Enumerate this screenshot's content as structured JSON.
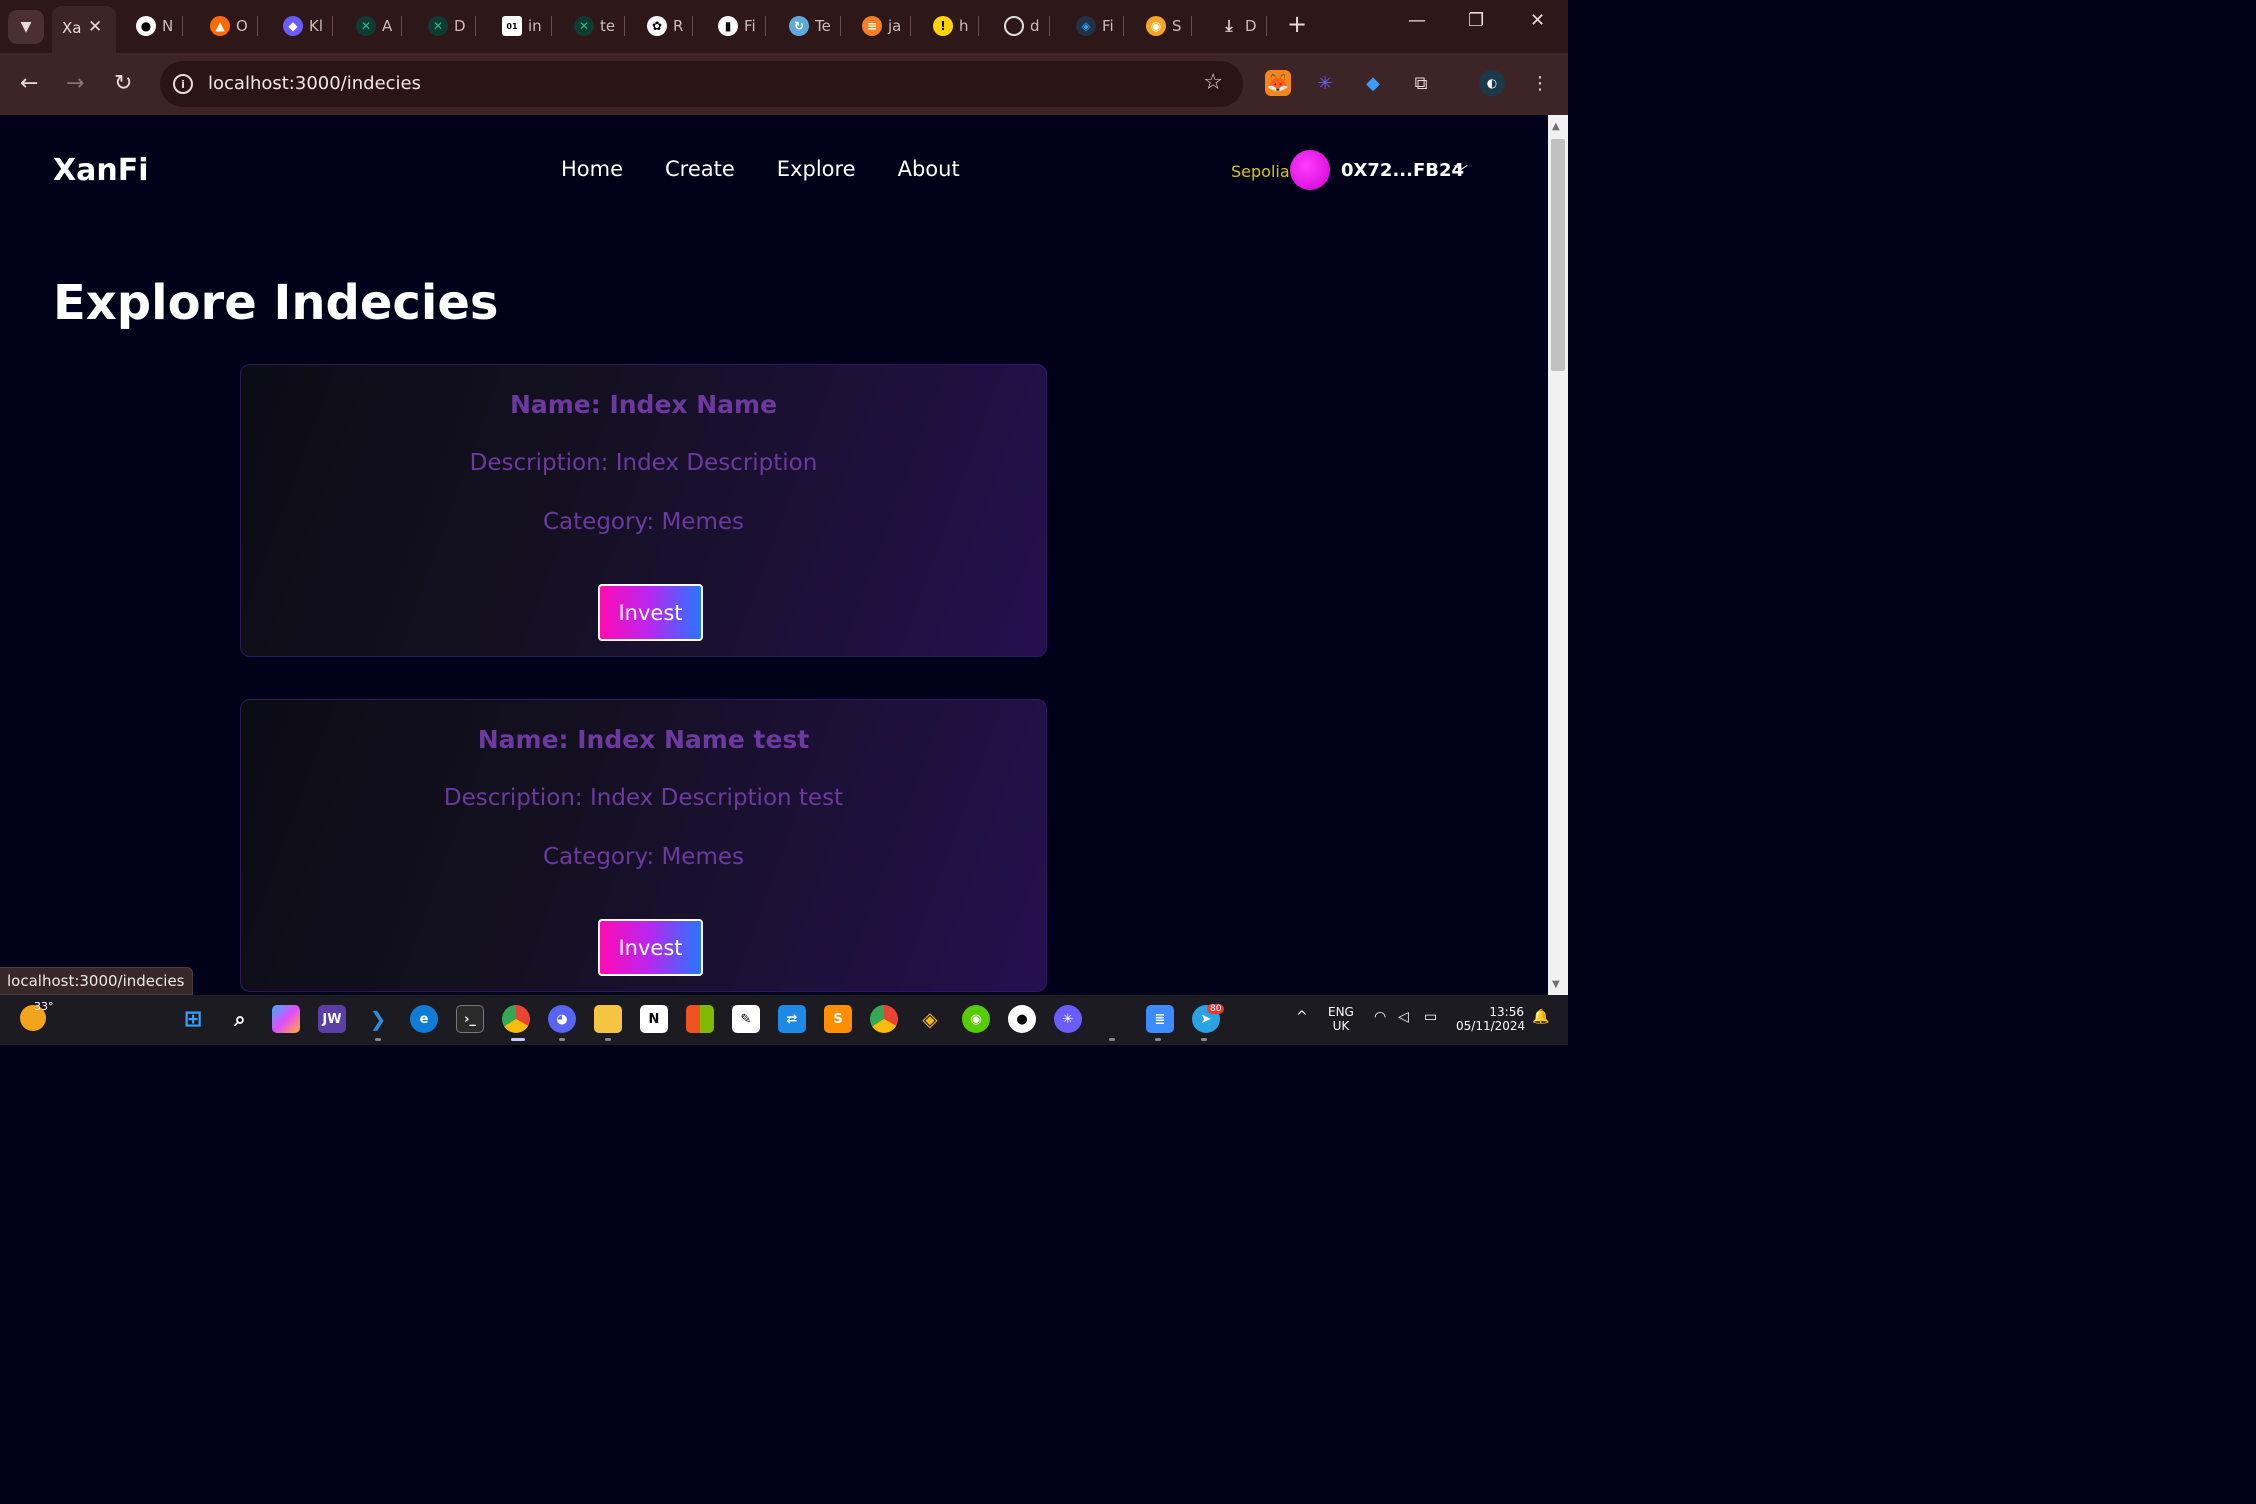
{
  "browser": {
    "active_tab_title": "Xa",
    "tabs": [
      {
        "label": "N",
        "icon": "github-icon",
        "color": "#ffffff"
      },
      {
        "label": "O",
        "icon": "flame-icon",
        "color": "#ff6a00"
      },
      {
        "label": "Kl",
        "icon": "kl-icon",
        "color": "#6b5cff"
      },
      {
        "label": "A",
        "icon": "cross-icon",
        "color": "#1fbf8f"
      },
      {
        "label": "D",
        "icon": "cross-icon",
        "color": "#1fbf8f"
      },
      {
        "label": "in",
        "icon": "binary-icon",
        "color": "#ffffff"
      },
      {
        "label": "te",
        "icon": "cross-icon",
        "color": "#1fbf8f"
      },
      {
        "label": "R",
        "icon": "openai-icon",
        "color": "#ffffff"
      },
      {
        "label": "Fi",
        "icon": "chart-icon",
        "color": "#ffffff"
      },
      {
        "label": "Te",
        "icon": "refresh-icon",
        "color": "#7ad"
      },
      {
        "label": "ja",
        "icon": "stackoverflow-icon",
        "color": "#f48024"
      },
      {
        "label": "h",
        "icon": "warning-icon",
        "color": "#ffd400"
      },
      {
        "label": "d",
        "icon": "cloud-icon",
        "color": "#ffffff"
      },
      {
        "label": "Fi",
        "icon": "arbitrum-icon",
        "color": "#28a0f0"
      },
      {
        "label": "S",
        "icon": "badge-icon",
        "color": "#f5a623"
      },
      {
        "label": "D",
        "icon": "download-icon",
        "color": "#ffffff"
      }
    ],
    "url": "localhost:3000/indecies",
    "status_url": "localhost:3000/indecies"
  },
  "site": {
    "brand": "XanFi",
    "nav": [
      "Home",
      "Create",
      "Explore",
      "About"
    ],
    "network": "Sepolia",
    "wallet": "0X72...FB24",
    "page_title": "Explore Indecies",
    "cards": [
      {
        "name": "Name: Index Name",
        "description": "Description: Index Description",
        "category": "Category: Memes",
        "button": "Invest"
      },
      {
        "name": "Name: Index Name test",
        "description": "Description: Index Description test",
        "category": "Category: Memes",
        "button": "Invest"
      }
    ]
  },
  "taskbar": {
    "weather_temp": "33°",
    "lang_top": "ENG",
    "lang_bottom": "UK",
    "time": "13:56",
    "date": "05/11/2024",
    "telegram_badge": "80"
  },
  "colors": {
    "page_bg": "#01011a",
    "card_text": "#6c3a9e",
    "network": "#d7c800",
    "invest_gradient": [
      "#ff0bb5",
      "#2876ff"
    ]
  }
}
